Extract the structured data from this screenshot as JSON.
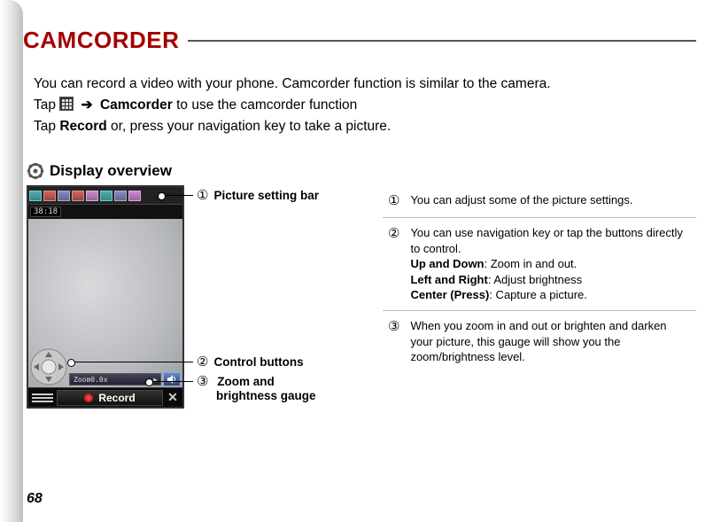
{
  "page": {
    "title": "CAMCORDER",
    "number": "68"
  },
  "intro": {
    "line1": "You can record a video with your phone. Camcorder function is similar to the camera.",
    "line2_pre": "Tap ",
    "line2_bold": "Camcorder",
    "line2_post": " to use the camcorder function",
    "line3_pre": "Tap ",
    "line3_bold": "Record",
    "line3_post": " or, press your navigation key to take a picture."
  },
  "section": {
    "heading": "Display overview"
  },
  "phone": {
    "counter": "38:18",
    "zoom_label": "Zoom0.0x",
    "record_label": "Record"
  },
  "callouts": {
    "c1": {
      "num": "①",
      "label": "Picture setting bar"
    },
    "c2": {
      "num": "②",
      "label": "Control buttons"
    },
    "c3": {
      "num": "③",
      "label1": "Zoom and",
      "label2": "brightness gauge"
    }
  },
  "descriptions": {
    "d1": {
      "num": "①",
      "text": "You can adjust some of the picture settings."
    },
    "d2": {
      "num": "②",
      "line1": "You can use navigation key or tap the buttons directly to control.",
      "upd_label": "Up and Down",
      "upd_text": ":  Zoom in and out.",
      "lr_label": "Left and Right",
      "lr_text": ": Adjust brightness",
      "c_label": "Center (Press)",
      "c_text": ": Capture a picture."
    },
    "d3": {
      "num": "③",
      "text": "When you zoom in and out or brighten and darken your picture, this gauge will show you the zoom/brightness level."
    }
  }
}
